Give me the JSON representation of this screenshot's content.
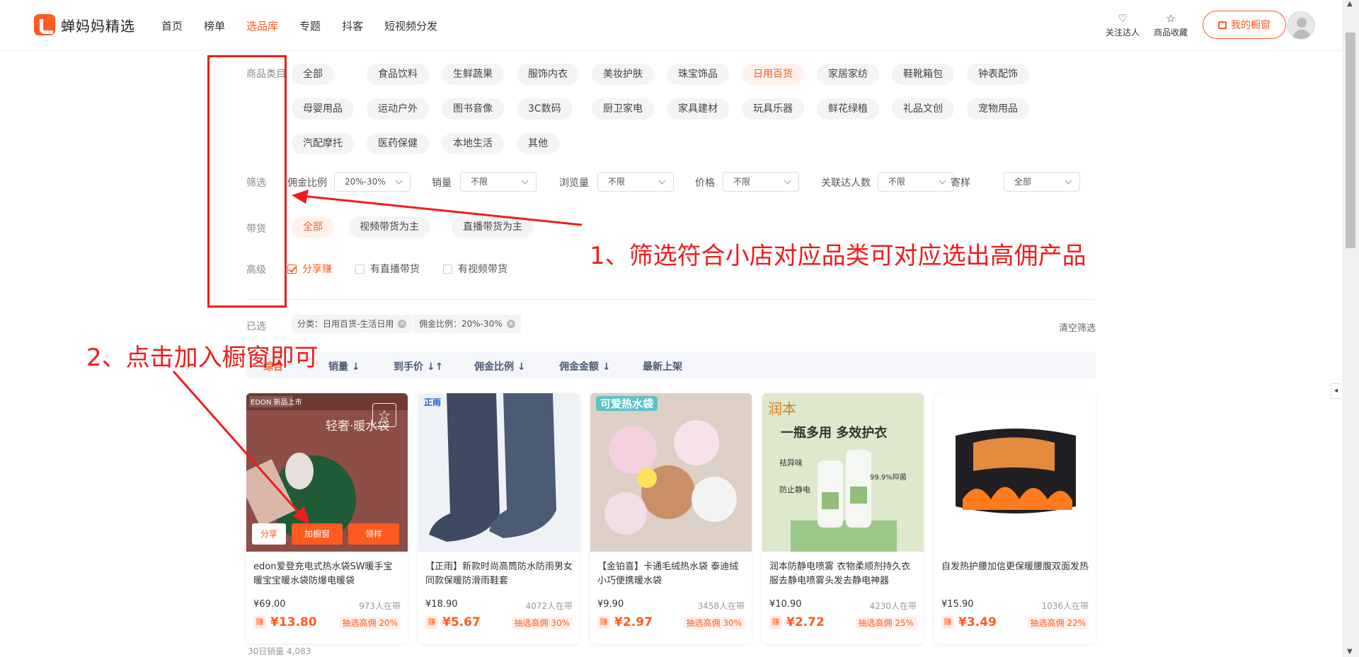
{
  "app": {
    "logo_text": "蝉妈妈精选"
  },
  "nav": [
    {
      "label": "首页"
    },
    {
      "label": "榜单"
    },
    {
      "label": "选品库",
      "active": true
    },
    {
      "label": "专题"
    },
    {
      "label": "抖客"
    },
    {
      "label": "短视频分发"
    }
  ],
  "header_right": {
    "follow_label": "关注达人",
    "collect_label": "商品收藏",
    "window_label": "我的橱窗"
  },
  "filters": {
    "category_label": "商品类目",
    "categories": [
      "全部",
      "食品饮料",
      "生鲜蔬果",
      "服饰内衣",
      "美妆护肤",
      "珠宝饰品",
      "日用百货",
      "家居家纺",
      "鞋靴箱包",
      "钟表配饰",
      "母婴用品",
      "运动户外",
      "图书音像",
      "3C数码",
      "厨卫家电",
      "家具建材",
      "玩具乐器",
      "鲜花绿植",
      "礼品文创",
      "宠物用品",
      "汽配摩托",
      "医药保健",
      "本地生活",
      "其他"
    ],
    "active_category": "日用百货",
    "screen_label": "筛选",
    "selects": [
      {
        "label": "佣金比例",
        "value": "20%-30%"
      },
      {
        "label": "销量",
        "value": "不限"
      },
      {
        "label": "浏览量",
        "value": "不限"
      },
      {
        "label": "价格",
        "value": "不限"
      },
      {
        "label": "关联达人数",
        "value": "不限"
      },
      {
        "label": "寄样",
        "value": "全部"
      }
    ],
    "goods_label": "带货",
    "goods_options": [
      "全部",
      "视频带货为主",
      "直播带货为主"
    ],
    "advanced_label": "高级",
    "advanced": [
      {
        "label": "分享赚",
        "checked": true
      },
      {
        "label": "有直播带货",
        "checked": false
      },
      {
        "label": "有视频带货",
        "checked": false
      }
    ],
    "selected_label": "已选",
    "selected_tags": [
      "分类：日用百货-生活日用",
      "佣金比例：20%-30%"
    ],
    "clear_label": "清空筛选"
  },
  "sort": [
    {
      "label": "综合",
      "active": true
    },
    {
      "label": "销量 ↓"
    },
    {
      "label": "到手价 ↓↑"
    },
    {
      "label": "佣金比例 ↓"
    },
    {
      "label": "佣金金额 ↓"
    },
    {
      "label": "最新上架"
    }
  ],
  "products": [
    {
      "title": "edon爱登充电式热水袋SW暖手宝暖宝宝暖水袋防爆电暖袋",
      "price": "¥69.00",
      "sold": "973人在带",
      "earn": "¥13.80",
      "rate": "抽选高佣 20%",
      "badge": "EDON 新品上市",
      "overlay": "轻奢·暖水袋"
    },
    {
      "title": "【正雨】新款时尚高筒防水防雨男女同款保暖防滑雨鞋套",
      "price": "¥18.90",
      "sold": "4072人在带",
      "earn": "¥5.67",
      "rate": "抽选高佣 30%",
      "badge": "正雨"
    },
    {
      "title": "【金铂喜】卡通毛绒热水袋 泰迪绒小巧便携暖水袋",
      "price": "¥9.90",
      "sold": "3458人在带",
      "earn": "¥2.97",
      "rate": "抽选高佣 30%",
      "badge": "可爱热水袋"
    },
    {
      "title": "润本防静电喷雾 衣物柔顺剂持久衣服去静电喷雾头发去静电神器",
      "price": "¥10.90",
      "sold": "4230人在带",
      "earn": "¥2.72",
      "rate": "抽选高佣 25%",
      "badge": "润本",
      "overlay": "一瓶多用 多效护衣",
      "point1": "祛异味",
      "point2": "防止静电",
      "point3": "99.9%抑菌"
    },
    {
      "title": "自发热护腰加信更保暖腰腹双面发热",
      "price": "¥15.90",
      "sold": "1036人在带",
      "earn": "¥3.49",
      "rate": "抽选高佣 22%"
    }
  ],
  "card_actions": {
    "share": "分享",
    "add_window": "加橱窗",
    "sample": "领样"
  },
  "earn_tag": "赚",
  "partial_text": "30日销量 4,083",
  "annotations": {
    "step1": "1、筛选符合小店对应品类可对应选出高佣产品",
    "step2": "2、点击加入橱窗即可",
    "color": "#f01c1c"
  }
}
